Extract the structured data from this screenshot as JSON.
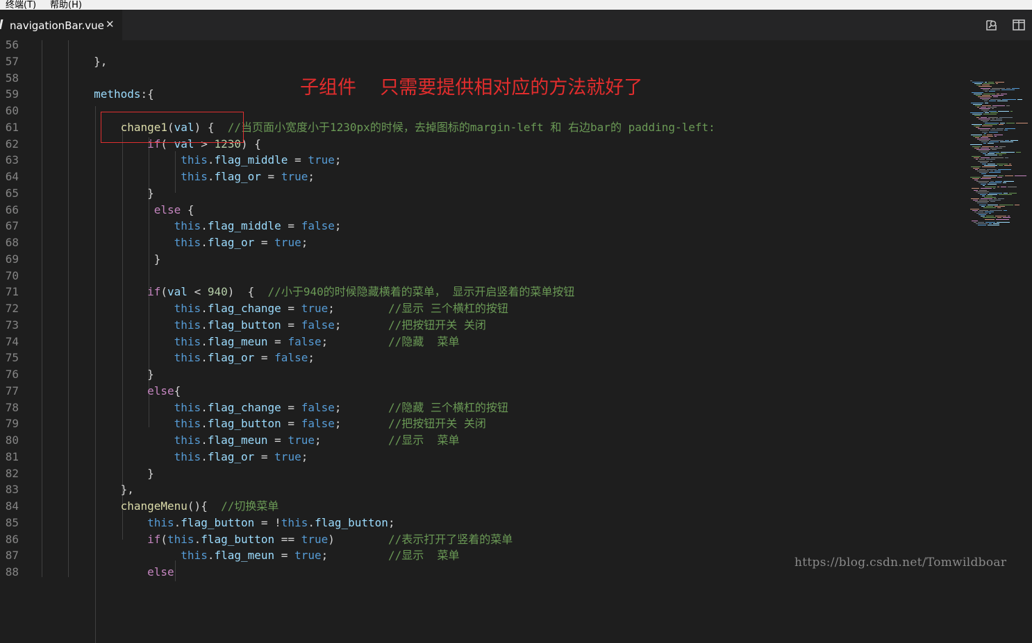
{
  "menu": {
    "items": [
      "终端(T)",
      "帮助(H)"
    ]
  },
  "tab": {
    "title": "navigationBar.vue",
    "close_glyph": "✕"
  },
  "toolbar_icons": [
    "open-preview-icon",
    "split-editor-icon"
  ],
  "annotation": "子组件    只需要提供相对应的方法就好了",
  "watermark": "https://blog.csdn.net/Tomwildboar",
  "colors": {
    "background": "#1e1e1e",
    "keyword": "#569cd6",
    "control_keyword": "#c586c0",
    "property": "#9cdcfe",
    "function": "#dcdcaa",
    "number": "#b5cea8",
    "comment": "#6a9955",
    "annotation": "#e22d2d"
  },
  "lines": [
    {
      "n": "56",
      "tokens": []
    },
    {
      "n": "57",
      "tokens": [
        [
          "t",
          "        },"
        ]
      ]
    },
    {
      "n": "58",
      "tokens": []
    },
    {
      "n": "59",
      "tokens": [
        [
          "p",
          "        methods"
        ],
        [
          "t",
          ":{"
        ]
      ]
    },
    {
      "n": "60",
      "tokens": []
    },
    {
      "n": "61",
      "tokens": [
        [
          "f",
          "            change1"
        ],
        [
          "t",
          "("
        ],
        [
          "p",
          "val"
        ],
        [
          "t",
          ") {  "
        ],
        [
          "c",
          "//当页面小宽度小于1230px的时候，去掉图标的margin-left 和 右边bar的 padding-left:"
        ]
      ]
    },
    {
      "n": "62",
      "tokens": [
        [
          "k",
          "                if"
        ],
        [
          "t",
          "( "
        ],
        [
          "p",
          "val"
        ],
        [
          "t",
          " > "
        ],
        [
          "n",
          "1230"
        ],
        [
          "t",
          ") {"
        ]
      ]
    },
    {
      "n": "63",
      "tokens": [
        [
          "kw",
          "                     this"
        ],
        [
          "t",
          "."
        ],
        [
          "p",
          "flag_middle"
        ],
        [
          "t",
          " = "
        ],
        [
          "kw",
          "true"
        ],
        [
          "t",
          ";"
        ]
      ]
    },
    {
      "n": "64",
      "tokens": [
        [
          "kw",
          "                     this"
        ],
        [
          "t",
          "."
        ],
        [
          "p",
          "flag_or"
        ],
        [
          "t",
          " = "
        ],
        [
          "kw",
          "true"
        ],
        [
          "t",
          ";"
        ]
      ]
    },
    {
      "n": "65",
      "tokens": [
        [
          "t",
          "                }"
        ]
      ]
    },
    {
      "n": "66",
      "tokens": [
        [
          "k",
          "                 else"
        ],
        [
          "t",
          " {"
        ]
      ]
    },
    {
      "n": "67",
      "tokens": [
        [
          "kw",
          "                    this"
        ],
        [
          "t",
          "."
        ],
        [
          "p",
          "flag_middle"
        ],
        [
          "t",
          " = "
        ],
        [
          "kw",
          "false"
        ],
        [
          "t",
          ";"
        ]
      ]
    },
    {
      "n": "68",
      "tokens": [
        [
          "kw",
          "                    this"
        ],
        [
          "t",
          "."
        ],
        [
          "p",
          "flag_or"
        ],
        [
          "t",
          " = "
        ],
        [
          "kw",
          "true"
        ],
        [
          "t",
          ";"
        ]
      ]
    },
    {
      "n": "69",
      "tokens": [
        [
          "t",
          "                 }"
        ]
      ]
    },
    {
      "n": "70",
      "tokens": []
    },
    {
      "n": "71",
      "tokens": [
        [
          "k",
          "                if"
        ],
        [
          "t",
          "("
        ],
        [
          "p",
          "val"
        ],
        [
          "t",
          " < "
        ],
        [
          "n",
          "940"
        ],
        [
          "t",
          ")  {  "
        ],
        [
          "c",
          "//小于940的时候隐藏横着的菜单， 显示开启竖着的菜单按钮"
        ]
      ]
    },
    {
      "n": "72",
      "tokens": [
        [
          "kw",
          "                    this"
        ],
        [
          "t",
          "."
        ],
        [
          "p",
          "flag_change"
        ],
        [
          "t",
          " = "
        ],
        [
          "kw",
          "true"
        ],
        [
          "t",
          ";        "
        ],
        [
          "c",
          "//显示 三个横杠的按钮"
        ]
      ]
    },
    {
      "n": "73",
      "tokens": [
        [
          "kw",
          "                    this"
        ],
        [
          "t",
          "."
        ],
        [
          "p",
          "flag_button"
        ],
        [
          "t",
          " = "
        ],
        [
          "kw",
          "false"
        ],
        [
          "t",
          ";       "
        ],
        [
          "c",
          "//把按钮开关 关闭"
        ]
      ]
    },
    {
      "n": "74",
      "tokens": [
        [
          "kw",
          "                    this"
        ],
        [
          "t",
          "."
        ],
        [
          "p",
          "flag_meun"
        ],
        [
          "t",
          " = "
        ],
        [
          "kw",
          "false"
        ],
        [
          "t",
          ";         "
        ],
        [
          "c",
          "//隐藏  菜单"
        ]
      ]
    },
    {
      "n": "75",
      "tokens": [
        [
          "kw",
          "                    this"
        ],
        [
          "t",
          "."
        ],
        [
          "p",
          "flag_or"
        ],
        [
          "t",
          " = "
        ],
        [
          "kw",
          "false"
        ],
        [
          "t",
          ";"
        ]
      ]
    },
    {
      "n": "76",
      "tokens": [
        [
          "t",
          "                }"
        ]
      ]
    },
    {
      "n": "77",
      "tokens": [
        [
          "k",
          "                else"
        ],
        [
          "t",
          "{"
        ]
      ]
    },
    {
      "n": "78",
      "tokens": [
        [
          "kw",
          "                    this"
        ],
        [
          "t",
          "."
        ],
        [
          "p",
          "flag_change"
        ],
        [
          "t",
          " = "
        ],
        [
          "kw",
          "false"
        ],
        [
          "t",
          ";       "
        ],
        [
          "c",
          "//隐藏 三个横杠的按钮"
        ]
      ]
    },
    {
      "n": "79",
      "tokens": [
        [
          "kw",
          "                    this"
        ],
        [
          "t",
          "."
        ],
        [
          "p",
          "flag_button"
        ],
        [
          "t",
          " = "
        ],
        [
          "kw",
          "false"
        ],
        [
          "t",
          ";       "
        ],
        [
          "c",
          "//把按钮开关 关闭"
        ]
      ]
    },
    {
      "n": "80",
      "tokens": [
        [
          "kw",
          "                    this"
        ],
        [
          "t",
          "."
        ],
        [
          "p",
          "flag_meun"
        ],
        [
          "t",
          " = "
        ],
        [
          "kw",
          "true"
        ],
        [
          "t",
          ";          "
        ],
        [
          "c",
          "//显示  菜单"
        ]
      ]
    },
    {
      "n": "81",
      "tokens": [
        [
          "kw",
          "                    this"
        ],
        [
          "t",
          "."
        ],
        [
          "p",
          "flag_or"
        ],
        [
          "t",
          " = "
        ],
        [
          "kw",
          "true"
        ],
        [
          "t",
          ";"
        ]
      ]
    },
    {
      "n": "82",
      "tokens": [
        [
          "t",
          "                }"
        ]
      ]
    },
    {
      "n": "83",
      "tokens": [
        [
          "t",
          "            },"
        ]
      ]
    },
    {
      "n": "84",
      "tokens": [
        [
          "f",
          "            changeMenu"
        ],
        [
          "t",
          "(){  "
        ],
        [
          "c",
          "//切换菜单"
        ]
      ]
    },
    {
      "n": "85",
      "tokens": [
        [
          "kw",
          "                this"
        ],
        [
          "t",
          "."
        ],
        [
          "p",
          "flag_button"
        ],
        [
          "t",
          " = !"
        ],
        [
          "kw",
          "this"
        ],
        [
          "t",
          "."
        ],
        [
          "p",
          "flag_button"
        ],
        [
          "t",
          ";"
        ]
      ]
    },
    {
      "n": "86",
      "tokens": [
        [
          "k",
          "                if"
        ],
        [
          "t",
          "("
        ],
        [
          "kw",
          "this"
        ],
        [
          "t",
          "."
        ],
        [
          "p",
          "flag_button"
        ],
        [
          "t",
          " == "
        ],
        [
          "kw",
          "true"
        ],
        [
          "t",
          ")        "
        ],
        [
          "c",
          "//表示打开了竖着的菜单"
        ]
      ]
    },
    {
      "n": "87",
      "tokens": [
        [
          "kw",
          "                     this"
        ],
        [
          "t",
          "."
        ],
        [
          "p",
          "flag_meun"
        ],
        [
          "t",
          " = "
        ],
        [
          "kw",
          "true"
        ],
        [
          "t",
          ";         "
        ],
        [
          "c",
          "//显示  菜单"
        ]
      ]
    },
    {
      "n": "88",
      "tokens": [
        [
          "k",
          "                else"
        ]
      ]
    }
  ]
}
